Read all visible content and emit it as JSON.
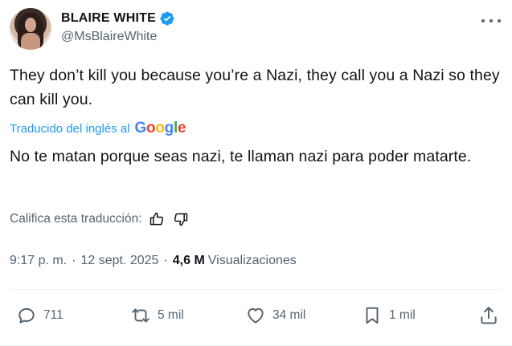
{
  "author": {
    "display_name": "BLAIRE WHITE",
    "handle": "@MsBlaireWhite",
    "verified": true
  },
  "tweet": {
    "text": "They don’t kill you because you’re a Nazi, they call you a Nazi so they can kill you.",
    "translated_label": "Traducido del inglés al",
    "translator_logo": [
      "G",
      "o",
      "o",
      "g",
      "l",
      "e"
    ],
    "translation": "No te matan porque seas nazi, te llaman nazi para poder matarte.",
    "rate_label": "Califica esta traducción:"
  },
  "meta": {
    "time": "9:17 p. m.",
    "separator": "·",
    "date": "12 sept. 2025",
    "views_count": "4,6 M",
    "views_label": "Visualizaciones"
  },
  "actions": {
    "replies": "711",
    "reposts": "5 mil",
    "likes": "34 mil",
    "bookmarks": "1 mil"
  },
  "colors": {
    "accent": "#1d9bf0",
    "text": "#0f1419",
    "secondary": "#536471",
    "divider": "#eff3f4"
  },
  "icons": [
    "verified-badge-icon",
    "more-options-icon",
    "thumbs-up-icon",
    "thumbs-down-icon",
    "reply-icon",
    "repost-icon",
    "like-icon",
    "bookmark-icon",
    "share-icon"
  ]
}
